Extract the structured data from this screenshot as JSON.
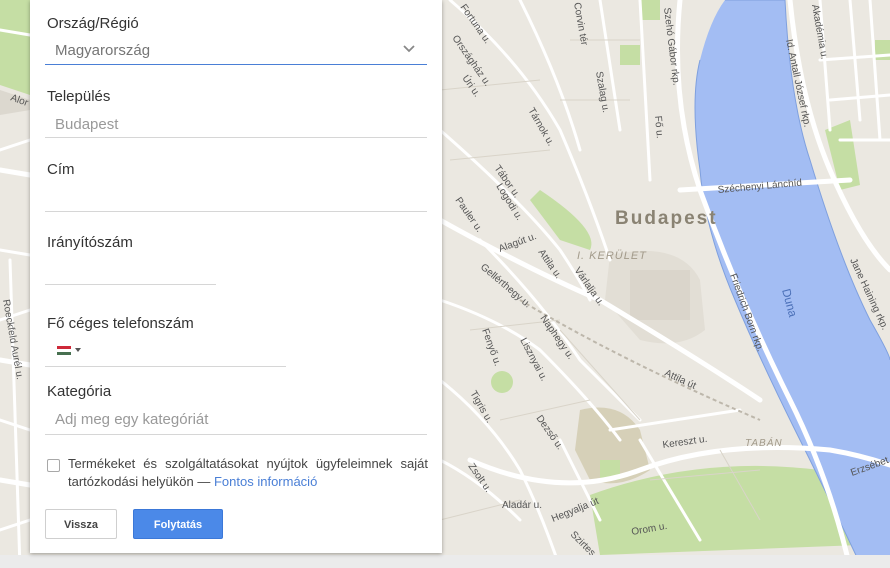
{
  "form": {
    "country_label": "Ország/Régió",
    "country_value": "Magyarország",
    "city_label": "Település",
    "city_placeholder": "Budapest",
    "address_label": "Cím",
    "address_value": "",
    "zip_label": "Irányítószám",
    "zip_value": "",
    "phone_label": "Fő céges telefonszám",
    "phone_value": "",
    "phone_country_flag": "hungary-flag",
    "category_label": "Kategória",
    "category_placeholder": "Adj meg egy kategóriát",
    "checkbox_text": "Termékeket és szolgáltatásokat nyújtok ügyfeleimnek saját tartózkodási helyükön —",
    "checkbox_link": "Fontos információ",
    "checkbox_checked": false,
    "back_button": "Vissza",
    "continue_button": "Folytatás"
  },
  "map": {
    "city": "Budapest",
    "district": "I. KERÜLET",
    "neighborhood": "TABÁN",
    "river": "Duna",
    "streets": {
      "fortuna": "Fortuna u.",
      "orszaghaz": "Országház u.",
      "uri": "Úri u.",
      "tarnok": "Tárnok u.",
      "szalag": "Szalag u.",
      "szeho_gabor": "Szehó Gábor rkp.",
      "fo": "Fő u.",
      "corvin": "Corvin tér",
      "akademia": "Akadémia u.",
      "antall": "Id. Antall József rkp.",
      "lanchid": "Széchenyi Lánchíd",
      "tabor": "Tábor u.",
      "logodi": "Logodi u.",
      "pauler": "Pauler u.",
      "alagut": "Alagút u.",
      "attila": "Attila u.",
      "varalja": "Várlalja u.",
      "gellerthegy": "Gellérthegy u.",
      "naphegy": "Naphegy u.",
      "fenyo": "Fenyő u.",
      "lisznyai": "Lisznyai u.",
      "attila_ut": "Attila út",
      "friedrich_born": "Friedrich Born rkp.",
      "hajnal": "Jane Haining rkp.",
      "tigris": "Tigris u.",
      "dezso": "Dezső u.",
      "kereszt": "Kereszt u.",
      "zsolt": "Zsolt u.",
      "hegyalja": "Hegyalja út",
      "aladar": "Aladár u.",
      "szirtes": "Szirtes u.",
      "orom": "Orom u.",
      "erzsebet": "Erzsébet",
      "roeck": "Roeckfeld Aurél u.",
      "alor": "Alor"
    }
  },
  "colors": {
    "accent": "#4b89e8",
    "link": "#4a7fd6",
    "water": "#a3bdf3",
    "park": "#c5dea4",
    "map_bg": "#ebe8e1"
  }
}
